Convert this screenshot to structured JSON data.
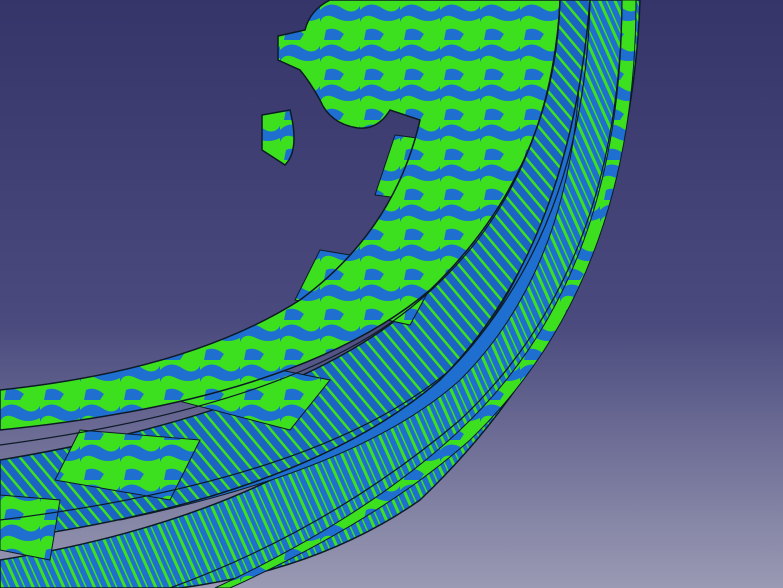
{
  "viewport": {
    "background": {
      "top": "#35356a",
      "mid": "#4a4a7e",
      "bottom": "#9a9ab4"
    },
    "part_colors": {
      "blue": "#1e6fd0",
      "green": "#3de01f",
      "dark_blue": "#174a9a",
      "edge": "#0d1a26"
    },
    "rung_count": 6
  }
}
